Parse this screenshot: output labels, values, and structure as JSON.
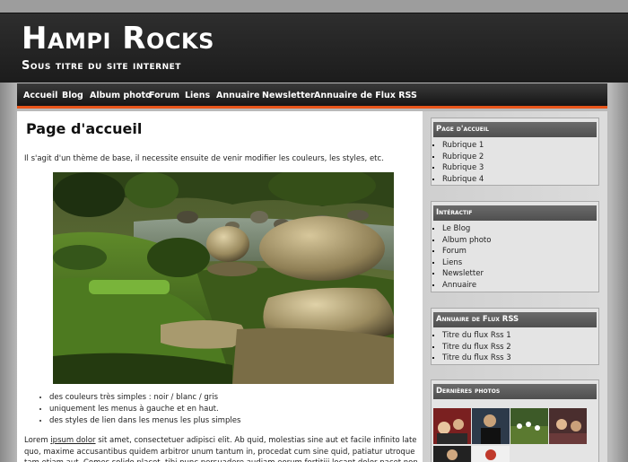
{
  "site": {
    "title": "Hampi Rocks",
    "subtitle": "Sous titre du site internet"
  },
  "nav": {
    "items": [
      {
        "label": "Accueil"
      },
      {
        "label": "Blog"
      },
      {
        "label": "Album photo"
      },
      {
        "label": "Forum"
      },
      {
        "label": "Liens"
      },
      {
        "label": "Annuaire"
      },
      {
        "label": "Newsletter"
      },
      {
        "label": "Annuaire de Flux RSS"
      }
    ]
  },
  "main": {
    "heading": "Page d'accueil",
    "intro": "Il s'agit d'un thème de base, il necessite ensuite de venir modifier les couleurs, les styles, etc.",
    "bullets": [
      "des couleurs très simples : noir / blanc / gris",
      "uniquement les menus à gauche et en haut.",
      "des styles de lien dans les menus les plus simples"
    ],
    "lorem_start": "Lorem ",
    "lorem_link": "ipsum dolor",
    "lorem_rest": " sit amet, consectetuer adipisci elit. Ab quid, molestias sine aut et facile infinito late quo, maxime accusantibus quidem arbitror unum tantum in, procedat cum sine quid, patiatur utroque tam etiam aut. Comes solido placet, tibi nunc persuadere audiam eorum fortitiii locant dolor nacet non assentuanur sunt"
  },
  "sidebar": {
    "widgets": [
      {
        "title": "Page d'accueil",
        "items": [
          "Rubrique 1",
          "Rubrique 2",
          "Rubrique 3",
          "Rubrique 4"
        ]
      },
      {
        "title": "Intéractif",
        "items": [
          "Le Blog",
          "Album photo",
          "Forum",
          "Liens",
          "Newsletter",
          "Annuaire"
        ]
      },
      {
        "title": "Annuaire de Flux RSS",
        "items": [
          "Titre du flux Rss 1",
          "Titre du flux Rss 2",
          "Titre du flux Rss 3"
        ]
      },
      {
        "title": "Dernières photos",
        "items": []
      }
    ]
  },
  "colors": {
    "accent": "#e8551a",
    "header_bg": "#222222",
    "widget_title_bg": "#5c5c5c"
  }
}
